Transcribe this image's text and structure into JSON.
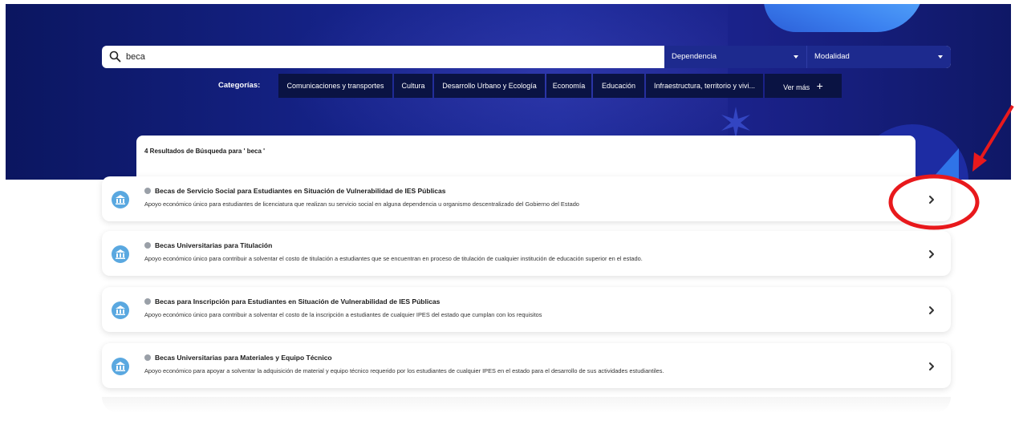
{
  "search": {
    "value": "beca",
    "placeholder": ""
  },
  "filters": {
    "dependencia": "Dependencia",
    "modalidad": "Modalidad"
  },
  "categories": {
    "label": "Categorías:",
    "items": [
      "Comunicaciones y transportes",
      "Cultura",
      "Desarrollo Urbano y Ecología",
      "Economía",
      "Educación",
      "Infraestructura, territorio y vivi..."
    ],
    "more": "Ver más",
    "more_icon": "+"
  },
  "results_header": "4 Resultados de Búsqueda para ' beca '",
  "results": [
    {
      "title": "Becas de Servicio Social para Estudiantes en Situación de Vulnerabilidad de IES Públicas",
      "description": "Apoyo económico único para estudiantes de licenciatura que realizan su servicio social en alguna dependencia u organismo descentralizado del Gobierno del Estado"
    },
    {
      "title": "Becas Universitarias para Titulación",
      "description": "Apoyo económico único para contribuir a solventar el costo de titulación a estudiantes que se encuentran en proceso de titulación de cualquier institución de educación superior en el estado."
    },
    {
      "title": "Becas para Inscripción para Estudiantes en Situación de Vulnerabilidad de IES Públicas",
      "description": "Apoyo económico único para contribuir a solventar el costo de la inscripción a estudiantes de cualquier IPES del estado que cumplan con los requisitos"
    },
    {
      "title": "Becas Universitarias para Materiales y Equipo Técnico",
      "description": "Apoyo económico para apoyar a solventar la adquisición de material y equipo técnico requerido por los estudiantes de cualquier IPES en el estado para el desarrollo de sus actividades estudiantiles."
    }
  ],
  "icons": {
    "search": "search-icon",
    "building": "building-icon",
    "info": "info-icon",
    "chevron": "chevron-right-icon",
    "caret": "caret-down-icon",
    "plus": "plus-icon"
  },
  "colors": {
    "hero_dark": "#0b1660",
    "hero_mid": "#1b2a9a",
    "chip_bg": "#0a1343",
    "select_bg": "#1d2a8e",
    "icon_circle": "#5aa8e0",
    "annotation_red": "#e8191c"
  }
}
